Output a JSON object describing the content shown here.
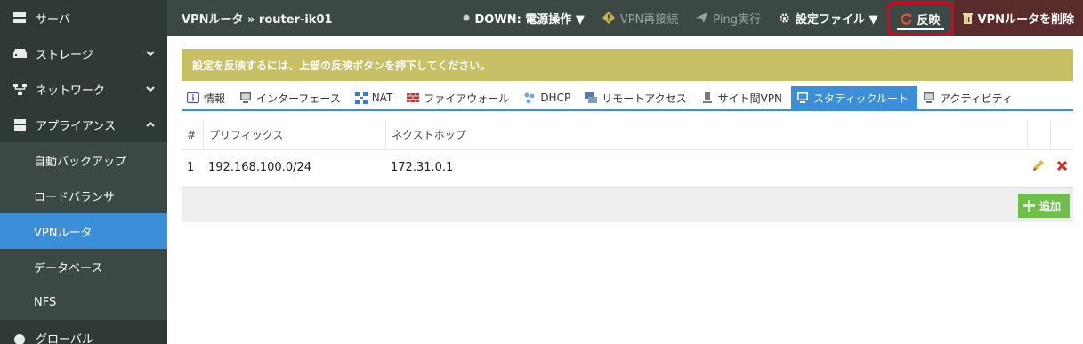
{
  "sidebar": {
    "items": [
      {
        "label": "サーバ",
        "icon": "server-icon"
      },
      {
        "label": "ストレージ",
        "icon": "storage-icon"
      },
      {
        "label": "ネットワーク",
        "icon": "network-icon"
      },
      {
        "label": "アプライアンス",
        "icon": "appliance-icon"
      }
    ],
    "sub_items": [
      {
        "label": "自動バックアップ"
      },
      {
        "label": "ロードバランサ"
      },
      {
        "label": "VPNルータ",
        "active": true
      },
      {
        "label": "データベース"
      },
      {
        "label": "NFS"
      }
    ],
    "partial_item": {
      "label": "グローバル",
      "icon": "globe-icon"
    }
  },
  "topbar": {
    "title": "VPNルータ » router-ik01",
    "status": "DOWN: 電源操作 ▼",
    "reconnect": "VPN再接続",
    "ping": "Ping実行",
    "config_file": "設定ファイル ▼",
    "reflect": "反映",
    "delete": "VPNルータを削除"
  },
  "notice": {
    "text": "設定を反映するには、上部の反映ボタンを押下してください。"
  },
  "tabs": [
    {
      "label": "情報",
      "icon": "info-icon"
    },
    {
      "label": "インターフェース",
      "icon": "interface-icon"
    },
    {
      "label": "NAT",
      "icon": "nat-icon"
    },
    {
      "label": "ファイアウォール",
      "icon": "firewall-icon"
    },
    {
      "label": "DHCP",
      "icon": "dhcp-icon"
    },
    {
      "label": "リモートアクセス",
      "icon": "remote-access-icon"
    },
    {
      "label": "サイト間VPN",
      "icon": "site-vpn-icon"
    },
    {
      "label": "スタティックルート",
      "icon": "static-route-icon",
      "active": true
    },
    {
      "label": "アクティビティ",
      "icon": "activity-icon"
    }
  ],
  "table": {
    "headers": {
      "num": "#",
      "prefix": "プリフィックス",
      "nexthop": "ネクストホップ"
    },
    "rows": [
      {
        "num": "1",
        "prefix": "192.168.100.0/24",
        "nexthop": "172.31.0.1"
      }
    ]
  },
  "footer": {
    "add_label": "追加"
  },
  "colors": {
    "sidebar_bg": "#2f3a37",
    "topbar_bg": "#3c4844",
    "accent_blue": "#3a8fd8",
    "notice_bg": "#c8c064",
    "add_green": "#6cc04a",
    "highlight_red": "#e0001b"
  }
}
